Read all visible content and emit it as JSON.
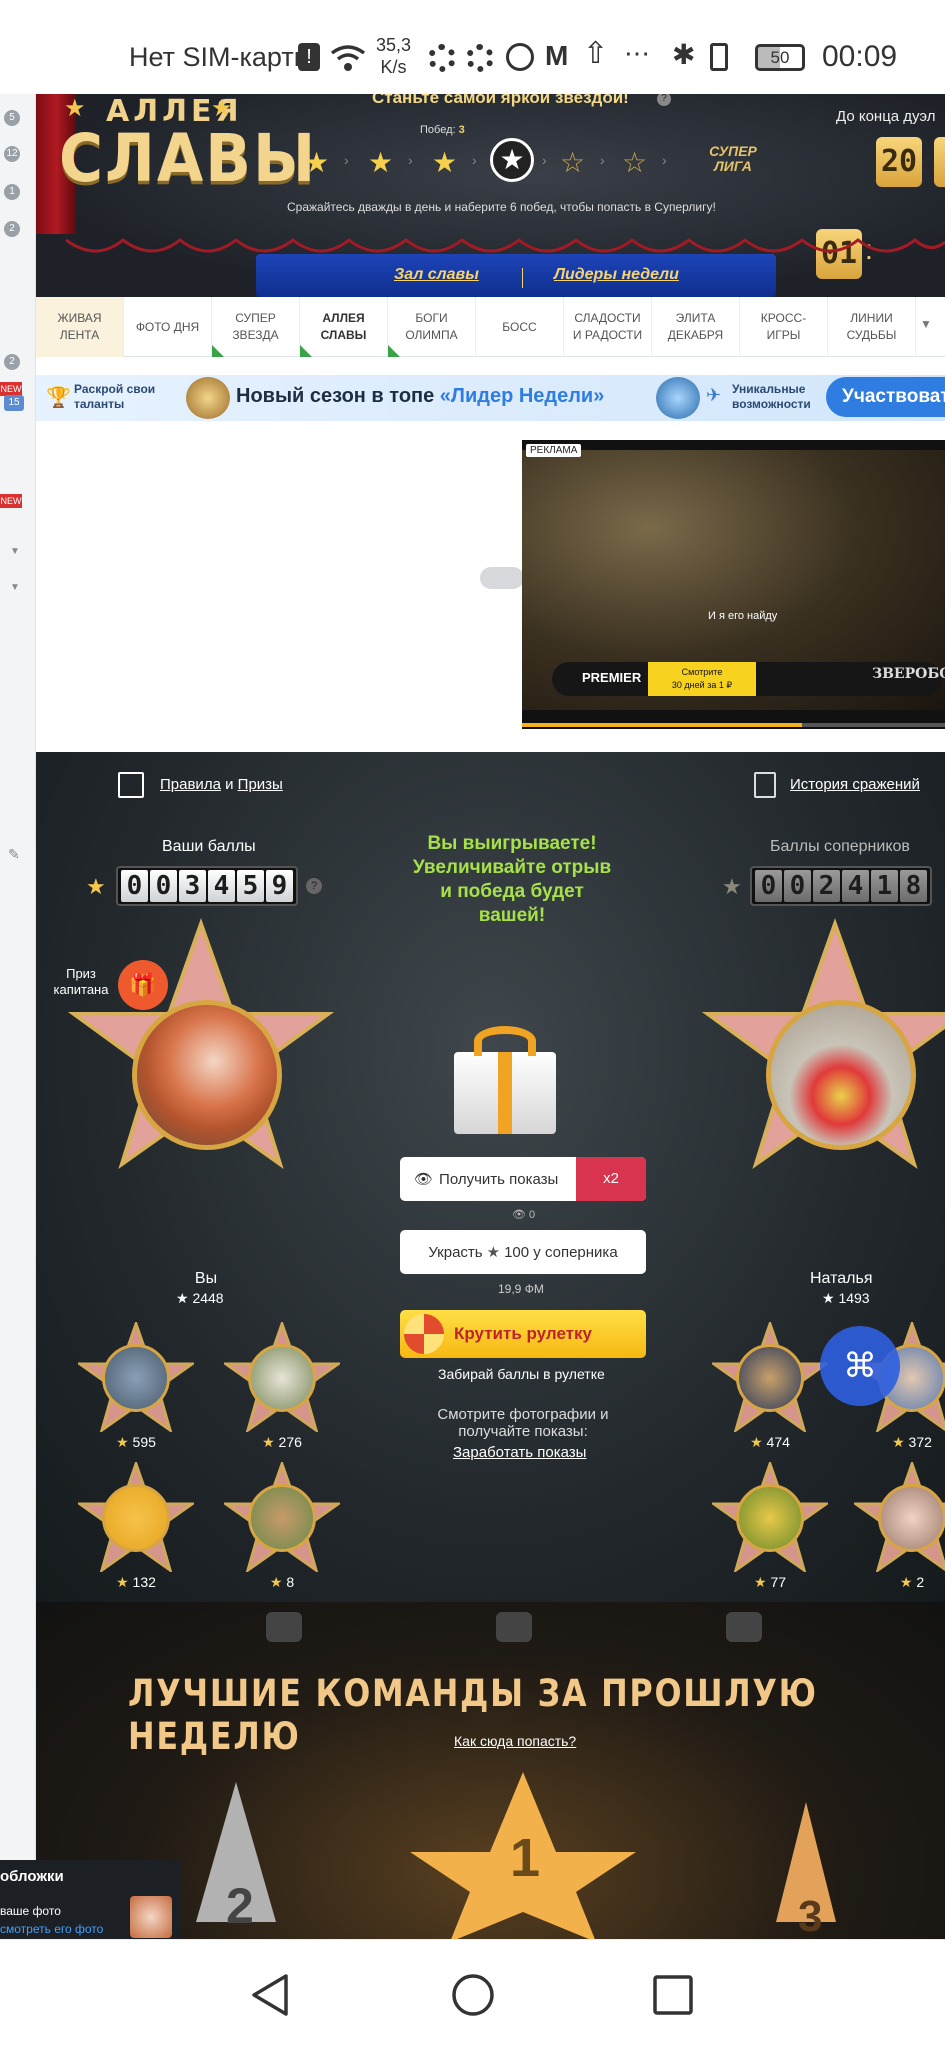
{
  "status_bar": {
    "carrier": "Нет SIM-карты",
    "speed_value": "35,3",
    "speed_unit": "K/s",
    "battery": "50",
    "time": "00:09"
  },
  "left_badges": [
    "5",
    "12",
    "1",
    "2",
    "2",
    "15"
  ],
  "left_new": [
    "NEW",
    "NEW"
  ],
  "header": {
    "top_text": "Станьте самой яркой звездой!",
    "logo_top": "АЛЛЕЯ",
    "logo_bottom": "СЛАВЫ",
    "wins_label": "Побед:",
    "wins_value": "3",
    "super_league": "СУПЕР ЛИГА",
    "description": "Сражайтесь дважды в день и наберите 6 побед, чтобы попасть в Суперлигу!",
    "timer_label": "До конца дуэл",
    "timer_digits": [
      "01",
      "20",
      "0"
    ],
    "hall_of_fame": "Зал славы",
    "leaders_week": "Лидеры недели"
  },
  "tabs": [
    {
      "label": "ЖИВАЯ ЛЕНТА",
      "marked": false
    },
    {
      "label": "ФОТО ДНЯ",
      "marked": false
    },
    {
      "label": "СУПЕР ЗВЕЗДА",
      "marked": true
    },
    {
      "label": "АЛЛЕЯ СЛАВЫ",
      "marked": true
    },
    {
      "label": "БОГИ ОЛИМПА",
      "marked": true
    },
    {
      "label": "БОСС",
      "marked": false
    },
    {
      "label": "СЛАДОСТИ И РАДОСТИ",
      "marked": false
    },
    {
      "label": "ЭЛИТА ДЕКАБРЯ",
      "marked": false
    },
    {
      "label": "КРОСС-ИГРЫ",
      "marked": false
    },
    {
      "label": "ЛИНИИ СУДЬБЫ",
      "marked": false
    }
  ],
  "banner": {
    "left_text": "Раскрой свои таланты",
    "main_text": "Новый сезон в топе",
    "highlight": "«Лидер Недели»",
    "right_text": "Уникальные возможности",
    "button": "Участвоват"
  },
  "ad": {
    "label": "РЕКЛАМА",
    "subtitle": "И я его найду",
    "brand": "PREMIER",
    "offer_line1": "Смотрите",
    "offer_line2": "30 дней за 1 ₽",
    "film_title": "ЗВЕРОБОЙ"
  },
  "game": {
    "rules": "Правила",
    "and": "и",
    "prizes": "Призы",
    "history": "История сражений",
    "your_points_label": "Ваши баллы",
    "your_points": "003459",
    "opp_points_label": "Баллы соперников",
    "opp_points": "002418",
    "winning_text": "Вы выигрываете! Увеличивайте отрыв и победа будет вашей!",
    "captain_prize": "Приз капитана",
    "get_views": "Получить показы",
    "x2": "x2",
    "views_count": "0",
    "decorate": "Украсть",
    "decorate_amount": "100 у соперника",
    "decorate_sub": "19,9 ФМ",
    "roulette": "Крутить рулетку",
    "roulette_sub": "Забирай баллы в рулетке",
    "earn_text": "Смотрите фотографии и получайте показы:",
    "earn_link": "Заработать показы",
    "you": {
      "name": "Вы",
      "points": "2448"
    },
    "opponent": {
      "name": "Наталья",
      "points": "1493"
    },
    "my_team": [
      {
        "points": "595"
      },
      {
        "points": "276"
      },
      {
        "points": "132"
      },
      {
        "points": "8"
      }
    ],
    "opp_team": [
      {
        "points": "474"
      },
      {
        "points": "372"
      },
      {
        "points": "77"
      },
      {
        "points": "2"
      }
    ]
  },
  "teams": {
    "title": "ЛУЧШИЕ КОМАНДЫ ЗА ПРОШЛУЮ НЕДЕЛЮ",
    "how_link": "Как сюда попасть?",
    "places": [
      "1",
      "2",
      "3"
    ]
  },
  "chat": {
    "title": "обложки",
    "line1": "ваше фото",
    "line2": "смотреть его фото"
  },
  "colors": {
    "gold": "#f3d58d",
    "ribbon_blue": "#1d44b8",
    "red_x2": "#d9344f",
    "roulette_yellow": "#f6c426",
    "win_green": "#a6e14a",
    "blue_button": "#2f7de1"
  }
}
